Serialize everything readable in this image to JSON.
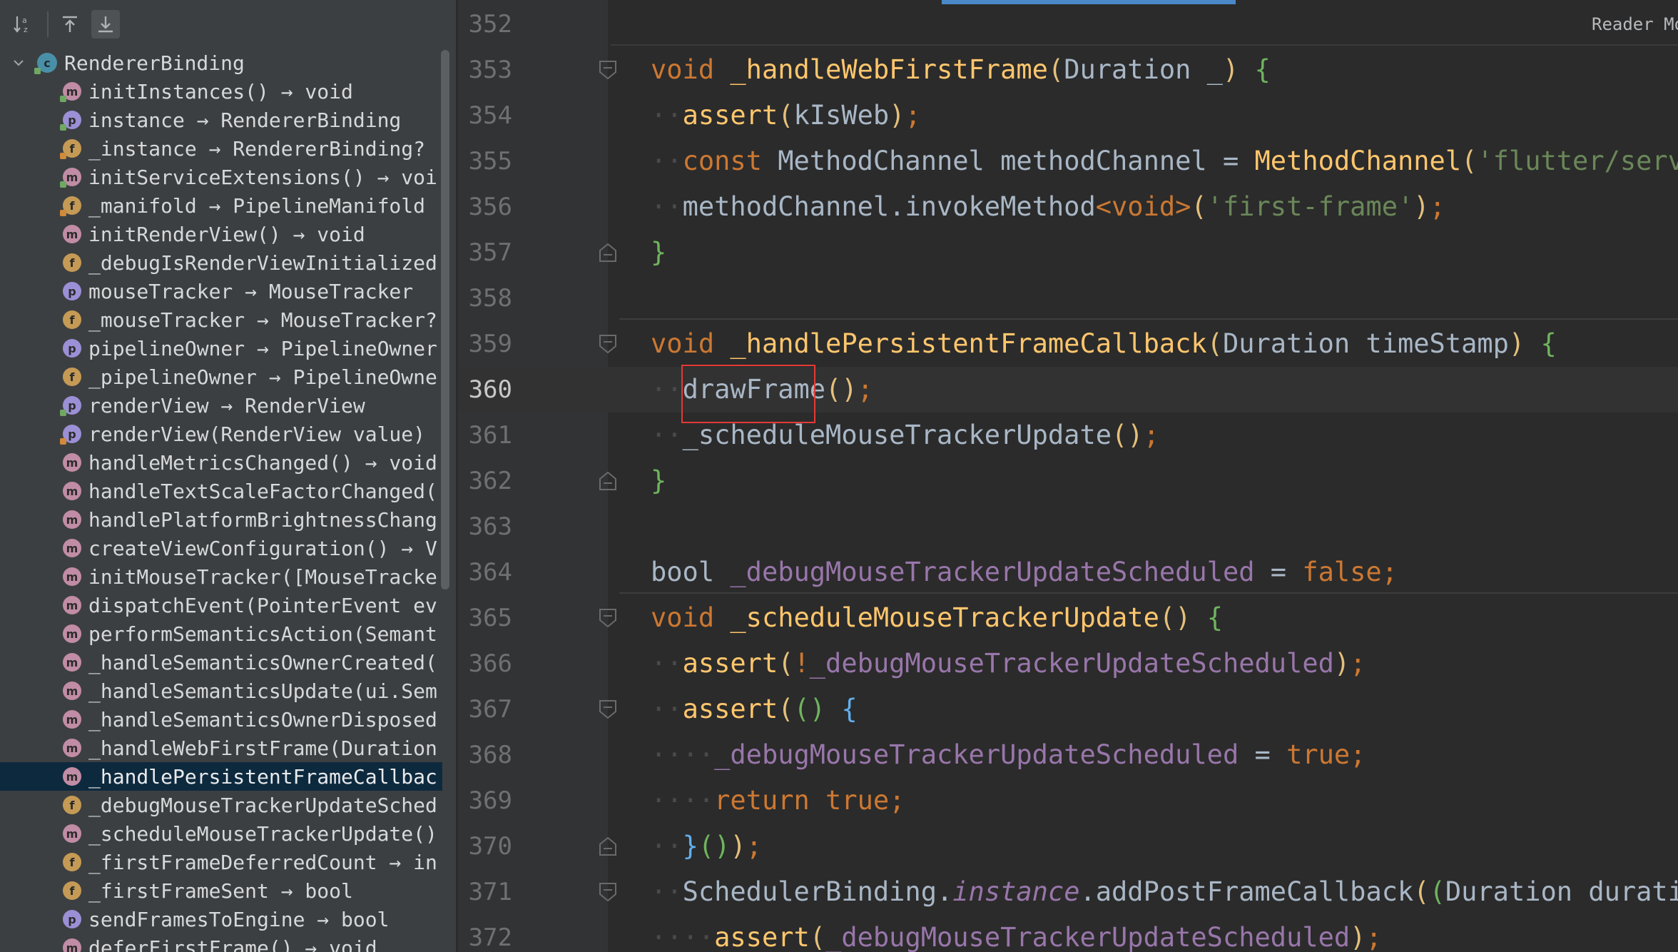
{
  "structure": {
    "toolbar": {
      "sort_icon_label": "↓a z",
      "expand_icon": "arrow-up-to-line",
      "collapse_icon": "arrow-down-to-line"
    },
    "root": {
      "label": "RendererBinding",
      "badge": "c"
    },
    "items": [
      {
        "badge": "m",
        "label": "initInstances() → void",
        "lock": "green"
      },
      {
        "badge": "p",
        "label": "instance → RendererBinding",
        "lock": "green"
      },
      {
        "badge": "f",
        "label": "_instance → RendererBinding?",
        "lock": "orange"
      },
      {
        "badge": "m",
        "label": "initServiceExtensions() → voi",
        "lock": "green"
      },
      {
        "badge": "f",
        "label": "_manifold → PipelineManifold",
        "lock": "orange"
      },
      {
        "badge": "m",
        "label": "initRenderView() → void",
        "lock": ""
      },
      {
        "badge": "f",
        "label": "_debugIsRenderViewInitialized",
        "lock": ""
      },
      {
        "badge": "p",
        "label": "mouseTracker → MouseTracker",
        "lock": ""
      },
      {
        "badge": "f",
        "label": "_mouseTracker → MouseTracker?",
        "lock": ""
      },
      {
        "badge": "p",
        "label": "pipelineOwner → PipelineOwner",
        "lock": ""
      },
      {
        "badge": "f",
        "label": "_pipelineOwner → PipelineOwne",
        "lock": ""
      },
      {
        "badge": "p",
        "label": "renderView → RenderView",
        "lock": "green"
      },
      {
        "badge": "p",
        "label": "renderView(RenderView value)",
        "lock": "orange"
      },
      {
        "badge": "m",
        "label": "handleMetricsChanged() → void",
        "lock": ""
      },
      {
        "badge": "m",
        "label": "handleTextScaleFactorChanged(",
        "lock": ""
      },
      {
        "badge": "m",
        "label": "handlePlatformBrightnessChang",
        "lock": ""
      },
      {
        "badge": "m",
        "label": "createViewConfiguration() → V",
        "lock": ""
      },
      {
        "badge": "m",
        "label": "initMouseTracker([MouseTracke",
        "lock": ""
      },
      {
        "badge": "m",
        "label": "dispatchEvent(PointerEvent ev",
        "lock": ""
      },
      {
        "badge": "m",
        "label": "performSemanticsAction(Semant",
        "lock": ""
      },
      {
        "badge": "m",
        "label": "_handleSemanticsOwnerCreated(",
        "lock": ""
      },
      {
        "badge": "m",
        "label": "_handleSemanticsUpdate(ui.Sem",
        "lock": ""
      },
      {
        "badge": "m",
        "label": "_handleSemanticsOwnerDisposed",
        "lock": ""
      },
      {
        "badge": "m",
        "label": "_handleWebFirstFrame(Duration",
        "lock": ""
      },
      {
        "badge": "m",
        "label": "_handlePersistentFrameCallbac",
        "lock": "",
        "selected": true
      },
      {
        "badge": "f",
        "label": "_debugMouseTrackerUpdateSched",
        "lock": ""
      },
      {
        "badge": "m",
        "label": "_scheduleMouseTrackerUpdate()",
        "lock": ""
      },
      {
        "badge": "f",
        "label": "_firstFrameDeferredCount → in",
        "lock": ""
      },
      {
        "badge": "f",
        "label": "_firstFrameSent → bool",
        "lock": ""
      },
      {
        "badge": "p",
        "label": "sendFramesToEngine → bool",
        "lock": ""
      },
      {
        "badge": "m",
        "label": "deferFirstFrame() → void",
        "lock": ""
      }
    ]
  },
  "editor": {
    "reader_mode_label": "Reader Mo",
    "current_line": 360,
    "lines": [
      {
        "n": "352",
        "segments": []
      },
      {
        "n": "353",
        "segments": [
          [
            "kw",
            "void"
          ],
          [
            "ty",
            " "
          ],
          [
            "fn",
            "_handleWebFirstFrame"
          ],
          [
            "brace-y",
            "("
          ],
          [
            "ty",
            "Duration _"
          ],
          [
            "brace-y",
            ")"
          ],
          [
            "ty",
            " "
          ],
          [
            "brace-g",
            "{"
          ]
        ],
        "fold": "open"
      },
      {
        "n": "354",
        "indent": 1,
        "segments": [
          [
            "fn",
            "assert"
          ],
          [
            "brace-y",
            "("
          ],
          [
            "ty",
            "kIsWeb"
          ],
          [
            "brace-y",
            ")"
          ],
          [
            "kw",
            ";"
          ]
        ]
      },
      {
        "n": "355",
        "indent": 1,
        "segments": [
          [
            "kw",
            "const"
          ],
          [
            "ty",
            " MethodChannel methodChannel = "
          ],
          [
            "cls",
            "MethodChannel"
          ],
          [
            "brace-y",
            "("
          ],
          [
            "str",
            "'flutter/service"
          ]
        ]
      },
      {
        "n": "356",
        "indent": 1,
        "segments": [
          [
            "ty",
            "methodChannel.invokeMethod"
          ],
          [
            "kw",
            "<void>"
          ],
          [
            "brace-y",
            "("
          ],
          [
            "str",
            "'first-frame'"
          ],
          [
            "brace-y",
            ")"
          ],
          [
            "kw",
            ";"
          ]
        ]
      },
      {
        "n": "357",
        "segments": [
          [
            "brace-g",
            "}"
          ]
        ],
        "fold": "close"
      },
      {
        "n": "358",
        "segments": []
      },
      {
        "n": "359",
        "segments": [
          [
            "kw",
            "void"
          ],
          [
            "ty",
            " "
          ],
          [
            "fn",
            "_handlePersistentFrameCallback"
          ],
          [
            "brace-y",
            "("
          ],
          [
            "ty",
            "Duration timeStamp"
          ],
          [
            "brace-y",
            ")"
          ],
          [
            "ty",
            " "
          ],
          [
            "brace-g",
            "{"
          ]
        ],
        "fold": "open"
      },
      {
        "n": "360",
        "indent": 1,
        "segments": [
          [
            "ty",
            "drawFrame"
          ],
          [
            "brace-y",
            "()"
          ],
          [
            "kw",
            ";"
          ]
        ]
      },
      {
        "n": "361",
        "indent": 1,
        "segments": [
          [
            "ty",
            "_scheduleMouseTrackerUpdate"
          ],
          [
            "brace-y",
            "()"
          ],
          [
            "kw",
            ";"
          ]
        ]
      },
      {
        "n": "362",
        "segments": [
          [
            "brace-g",
            "}"
          ]
        ],
        "fold": "close"
      },
      {
        "n": "363",
        "segments": []
      },
      {
        "n": "364",
        "segments": [
          [
            "ty",
            "bool "
          ],
          [
            "fld",
            "_debugMouseTrackerUpdateScheduled"
          ],
          [
            "ty",
            " = "
          ],
          [
            "kw",
            "false;"
          ]
        ]
      },
      {
        "n": "365",
        "segments": [
          [
            "kw",
            "void"
          ],
          [
            "ty",
            " "
          ],
          [
            "fn",
            "_scheduleMouseTrackerUpdate"
          ],
          [
            "brace-y",
            "()"
          ],
          [
            "ty",
            " "
          ],
          [
            "brace-g",
            "{"
          ]
        ],
        "fold": "open"
      },
      {
        "n": "366",
        "indent": 1,
        "segments": [
          [
            "fn",
            "assert"
          ],
          [
            "brace-y",
            "("
          ],
          [
            "kw",
            "!"
          ],
          [
            "fld",
            "_debugMouseTrackerUpdateScheduled"
          ],
          [
            "brace-y",
            ")"
          ],
          [
            "kw",
            ";"
          ]
        ]
      },
      {
        "n": "367",
        "indent": 1,
        "segments": [
          [
            "fn",
            "assert"
          ],
          [
            "brace-y",
            "("
          ],
          [
            "brace-g",
            "()"
          ],
          [
            "ty",
            " "
          ],
          [
            "brace-b",
            "{"
          ]
        ],
        "fold": "open"
      },
      {
        "n": "368",
        "indent": 2,
        "segments": [
          [
            "fld",
            "_debugMouseTrackerUpdateScheduled"
          ],
          [
            "ty",
            " = "
          ],
          [
            "kw",
            "true;"
          ]
        ]
      },
      {
        "n": "369",
        "indent": 2,
        "segments": [
          [
            "kw",
            "return true;"
          ]
        ]
      },
      {
        "n": "370",
        "indent": 1,
        "segments": [
          [
            "brace-b",
            "}"
          ],
          [
            "brace-g",
            "()"
          ],
          [
            "brace-y",
            ")"
          ],
          [
            "kw",
            ";"
          ]
        ],
        "fold": "close"
      },
      {
        "n": "371",
        "indent": 1,
        "segments": [
          [
            "ty",
            "SchedulerBinding."
          ],
          [
            "it",
            "instance"
          ],
          [
            "ty",
            ".addPostFrameCallback"
          ],
          [
            "brace-y",
            "("
          ],
          [
            "brace-g",
            "("
          ],
          [
            "ty",
            "Duration duration"
          ]
        ],
        "fold": "open"
      },
      {
        "n": "372",
        "indent": 2,
        "segments": [
          [
            "fn",
            "assert"
          ],
          [
            "brace-y",
            "("
          ],
          [
            "fld",
            "_debugMouseTrackerUpdateScheduled"
          ],
          [
            "brace-y",
            ")"
          ],
          [
            "kw",
            ";"
          ]
        ]
      }
    ]
  }
}
